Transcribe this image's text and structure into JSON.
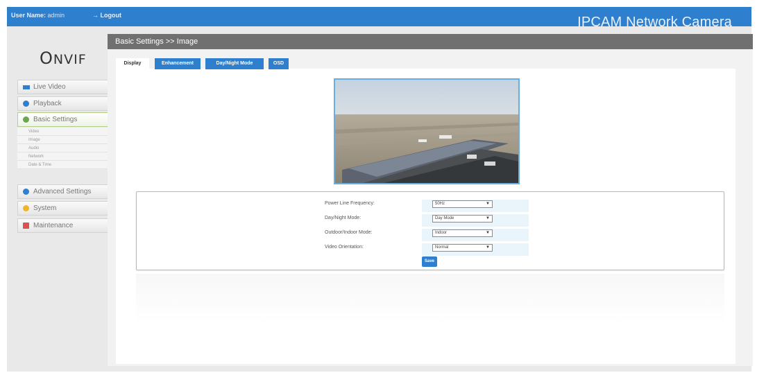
{
  "header": {
    "user_label": "User Name:",
    "user_value": "admin",
    "logout": "→ Logout",
    "brand": "IPCAM Network Camera"
  },
  "logo": {
    "text": "ONVIF"
  },
  "sidebar": {
    "items": [
      {
        "label": "Live Video",
        "icon": "live-video-icon",
        "color": "#2f7fcf"
      },
      {
        "label": "Playback",
        "icon": "playback-icon",
        "color": "#2f7fcf"
      },
      {
        "label": "Basic Settings",
        "icon": "basic-settings-icon",
        "color": "#6aa84f"
      },
      {
        "label": "Advanced Settings",
        "icon": "advanced-settings-icon",
        "color": "#2f7fcf"
      },
      {
        "label": "System",
        "icon": "system-icon",
        "color": "#f0b429"
      },
      {
        "label": "Maintenance",
        "icon": "maintenance-icon",
        "color": "#d9534f"
      }
    ],
    "sub_items": [
      "Video",
      "Image",
      "Audio",
      "Network",
      "Date & Time"
    ]
  },
  "main": {
    "breadcrumb": "Basic Settings >> Image",
    "tabs": [
      "Display",
      "Enhancement",
      "Day/Night Mode",
      "OSD"
    ],
    "active_tab": "Display"
  },
  "form": {
    "rows": [
      {
        "label": "Power Line Frequency:",
        "value": "50Hz"
      },
      {
        "label": "Day/Night Mode:",
        "value": "Day Mode"
      },
      {
        "label": "Outdoor/Indoor Mode:",
        "value": "Indoor"
      },
      {
        "label": "Video Orientation:",
        "value": "Normal"
      }
    ],
    "save_label": "Save"
  }
}
